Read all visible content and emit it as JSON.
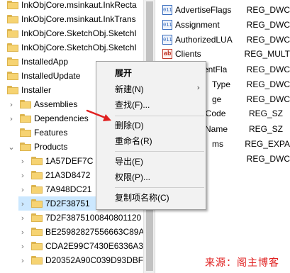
{
  "tree": {
    "items": [
      {
        "label": "InkObjCore.msinkaut.InkRecta",
        "arrow": ""
      },
      {
        "label": "InkObjCore.msinkaut.InkTrans",
        "arrow": ""
      },
      {
        "label": "InkObjCore.SketchObj.SketchI",
        "arrow": ""
      },
      {
        "label": "InkObjCore.SketchObj.SketchI",
        "arrow": ""
      },
      {
        "label": "InstalledApp",
        "arrow": ""
      },
      {
        "label": "InstalledUpdate",
        "arrow": ""
      },
      {
        "label": "Installer",
        "arrow": "⌄"
      },
      {
        "label": "Assemblies",
        "arrow": "›"
      },
      {
        "label": "Dependencies",
        "arrow": "›"
      },
      {
        "label": "Features",
        "arrow": ""
      },
      {
        "label": "Products",
        "arrow": "⌄"
      },
      {
        "label": "1A57DEF7C",
        "arrow": "›"
      },
      {
        "label": "21A3D8472",
        "arrow": "›"
      },
      {
        "label": "7A948DC21",
        "arrow": "›"
      },
      {
        "label": "7D2F38751",
        "arrow": "›"
      },
      {
        "label": "7D2F3875100840801120",
        "arrow": "›"
      },
      {
        "label": "BE25982827556663C89A",
        "arrow": "›"
      },
      {
        "label": "CDA2E99C7430E6336A3",
        "arrow": "›"
      },
      {
        "label": "D20352A90C039D93DBF",
        "arrow": "›"
      }
    ]
  },
  "values": {
    "rows": [
      {
        "name": "AdvertiseFlags",
        "type": "REG_DWC",
        "icon": "binary-icon",
        "glyph": "011"
      },
      {
        "name": "Assignment",
        "type": "REG_DWC",
        "icon": "binary-icon",
        "glyph": "011"
      },
      {
        "name": "AuthorizedLUA",
        "type": "REG_DWC",
        "icon": "binary-icon",
        "glyph": "011"
      },
      {
        "name": "Clients",
        "type": "REG_MULT",
        "icon": "string-icon",
        "glyph": "ab"
      },
      {
        "name": "mentFla",
        "type": "REG_DWC",
        "icon": "binary-icon",
        "glyph": "011"
      },
      {
        "name": "Type",
        "type": "REG_DWC",
        "icon": "binary-icon",
        "glyph": "011"
      },
      {
        "name": "ge",
        "type": "REG_DWC",
        "icon": "binary-icon",
        "glyph": "011"
      },
      {
        "name": "eCode",
        "type": "REG_SZ",
        "icon": "string-icon",
        "glyph": "ab"
      },
      {
        "name": "Name",
        "type": "REG_SZ",
        "icon": "string-icon",
        "glyph": "ab"
      },
      {
        "name": "ms",
        "type": "REG_EXPA",
        "icon": "string-icon",
        "glyph": "ab"
      },
      {
        "name": "",
        "type": "REG_DWC",
        "icon": "binary-icon",
        "glyph": "011"
      }
    ]
  },
  "context_menu": {
    "expand": "展开",
    "new": "新建(N)",
    "find": "查找(F)...",
    "delete": "删除(D)",
    "rename": "重命名(R)",
    "export": "导出(E)",
    "permissions": "权限(P)...",
    "copy_key_name": "复制项名称(C)"
  },
  "watermark": "来源：阁主博客",
  "colors": {
    "selection": "#cce8ff",
    "folder": "#f6d372",
    "watermark": "#e02020",
    "arrow": "#e02020"
  }
}
